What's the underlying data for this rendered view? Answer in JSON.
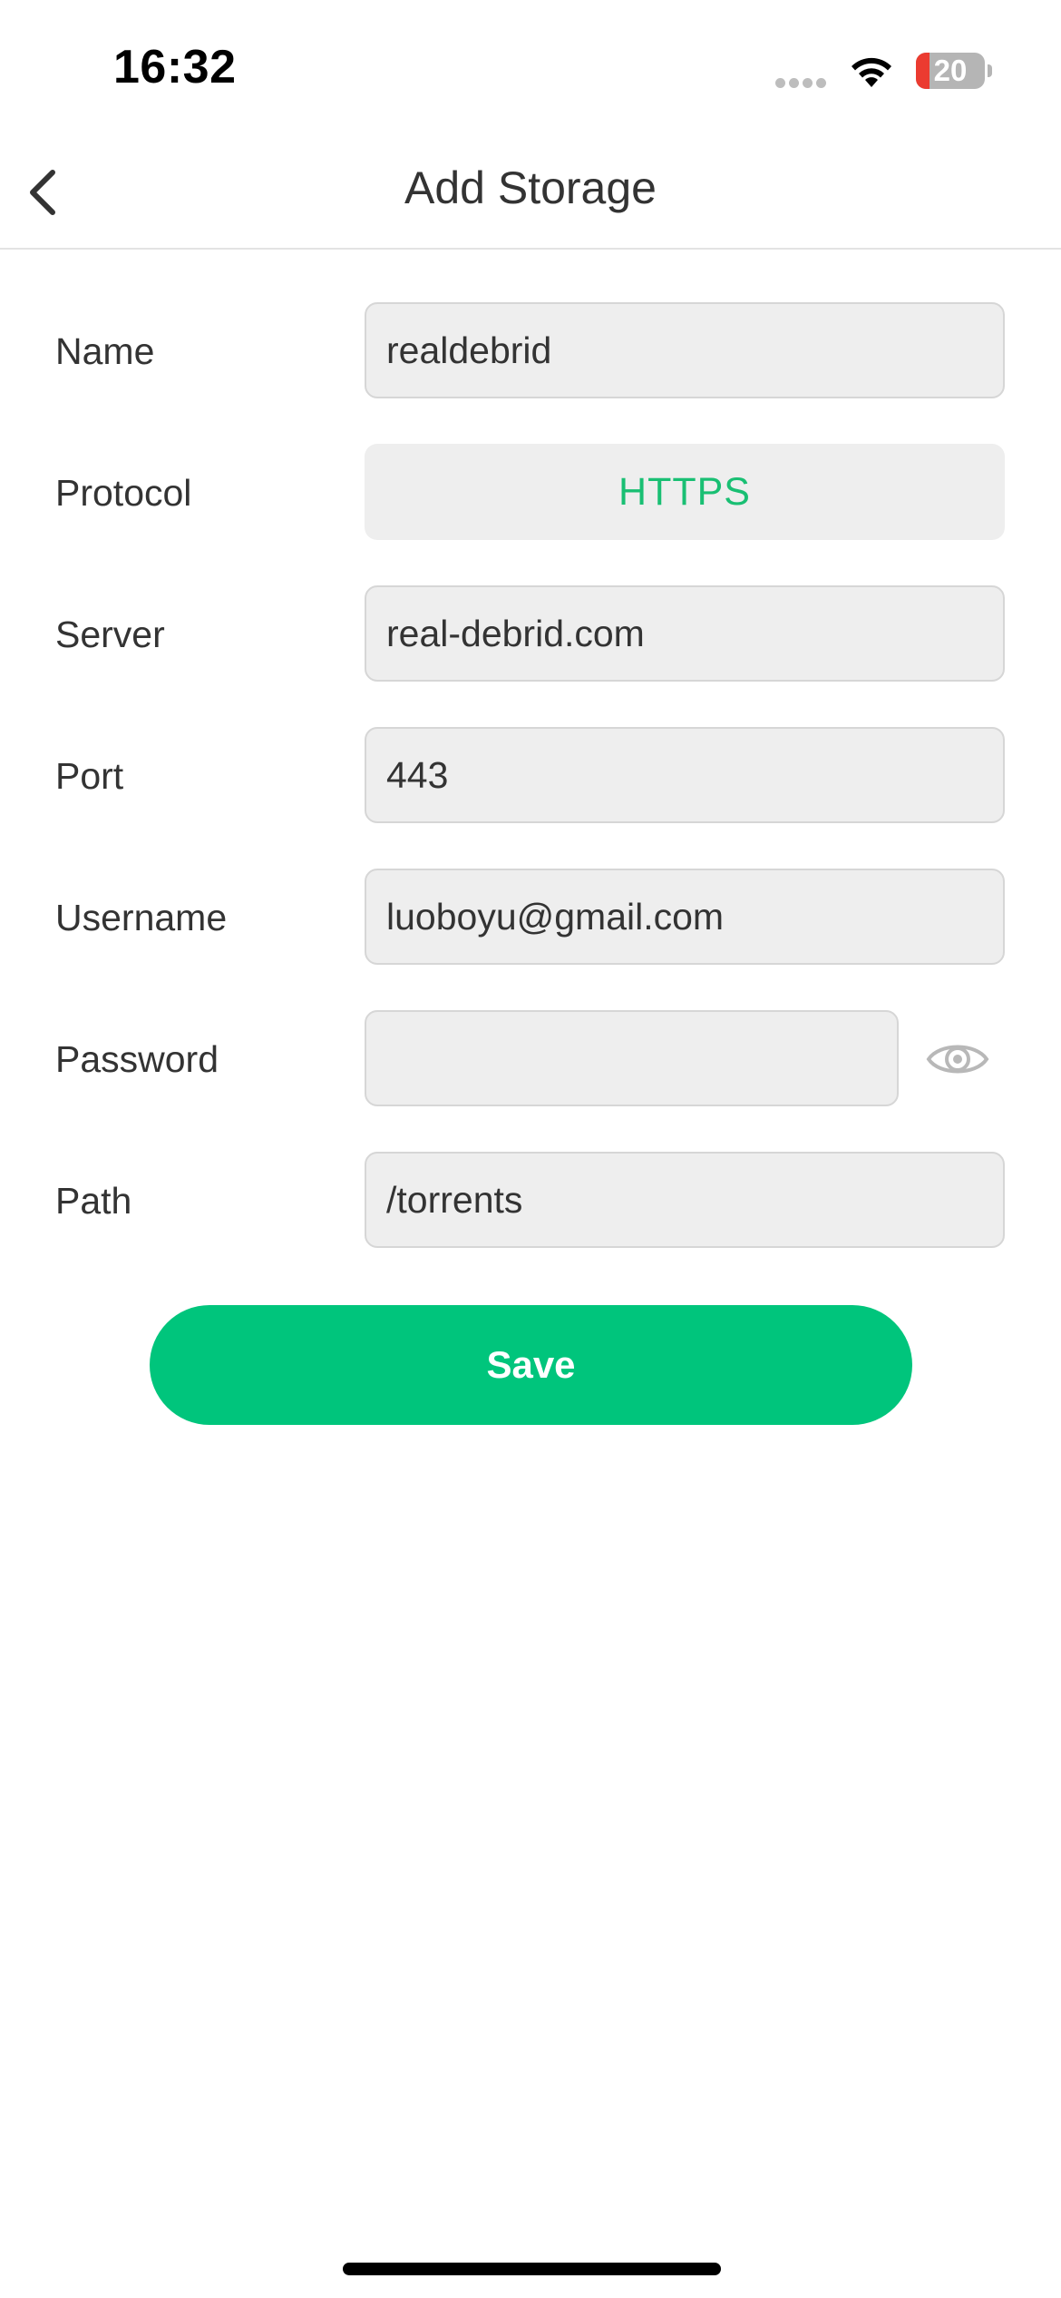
{
  "status_bar": {
    "time": "16:32",
    "battery_level": "20",
    "battery_fraction": 0.2
  },
  "nav": {
    "title": "Add Storage",
    "back_icon": "chevron-left-icon"
  },
  "form": {
    "name": {
      "label": "Name",
      "value": "realdebrid"
    },
    "protocol": {
      "label": "Protocol",
      "value": "HTTPS"
    },
    "server": {
      "label": "Server",
      "value": "real-debrid.com"
    },
    "port": {
      "label": "Port",
      "value": "443"
    },
    "username": {
      "label": "Username",
      "value": "luoboyu@gmail.com"
    },
    "password": {
      "label": "Password",
      "value": "",
      "toggle_icon": "eye-icon"
    },
    "path": {
      "label": "Path",
      "value": "/torrents"
    }
  },
  "actions": {
    "save_label": "Save"
  },
  "colors": {
    "accent": "#00c57c",
    "protocol_text": "#19bf73",
    "field_background": "#eeeeee",
    "battery_low": "#eb3b30"
  }
}
